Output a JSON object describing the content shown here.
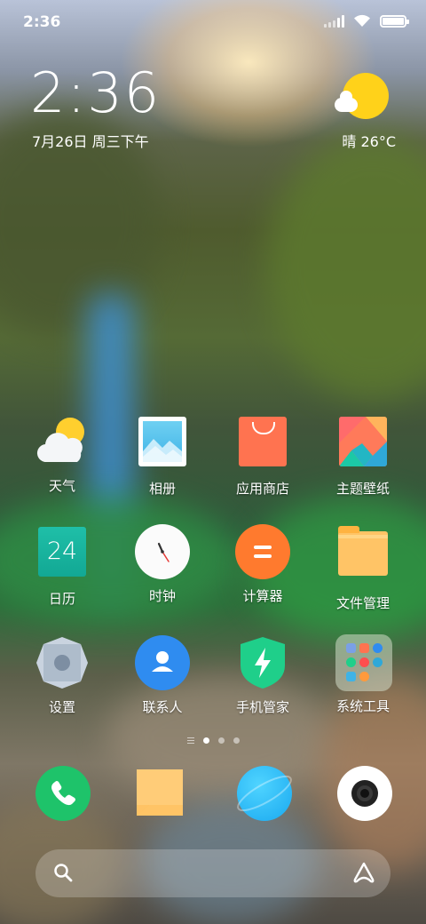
{
  "status_bar": {
    "time": "2:36"
  },
  "clock_widget": {
    "time": "2:36",
    "date": "7月26日 周三下午"
  },
  "weather_widget": {
    "condition": "晴",
    "temperature": "26°C",
    "icon": "sunny-partly-cloudy-icon"
  },
  "apps": [
    {
      "label": "天气",
      "icon": "weather-icon"
    },
    {
      "label": "相册",
      "icon": "gallery-icon"
    },
    {
      "label": "应用商店",
      "icon": "app-store-icon"
    },
    {
      "label": "主题壁纸",
      "icon": "themes-icon"
    },
    {
      "label": "日历",
      "icon": "calendar-icon",
      "badge_text": "24"
    },
    {
      "label": "时钟",
      "icon": "clock-icon"
    },
    {
      "label": "计算器",
      "icon": "calculator-icon"
    },
    {
      "label": "文件管理",
      "icon": "file-manager-icon"
    },
    {
      "label": "设置",
      "icon": "settings-gear-icon"
    },
    {
      "label": "联系人",
      "icon": "contacts-icon"
    },
    {
      "label": "手机管家",
      "icon": "security-shield-icon"
    },
    {
      "label": "系统工具",
      "icon": "folder-icon"
    }
  ],
  "page_indicator": {
    "pages": 3,
    "active_page": 1
  },
  "dock": [
    {
      "icon": "phone-icon"
    },
    {
      "icon": "messages-icon"
    },
    {
      "icon": "browser-icon"
    },
    {
      "icon": "camera-icon"
    }
  ],
  "search_bar": {
    "left_icon": "search-icon",
    "right_icon": "assistant-icon"
  },
  "colors": {
    "sun": "#ffd21a",
    "app_store": "#ff7350",
    "calendar": "#1fbfa8",
    "calculator": "#ff7a2e",
    "folder": "#ffc466",
    "contacts": "#2f8cf0",
    "security": "#1fcf8a",
    "phone": "#1ec36a",
    "browser": "#1aa9f0"
  }
}
